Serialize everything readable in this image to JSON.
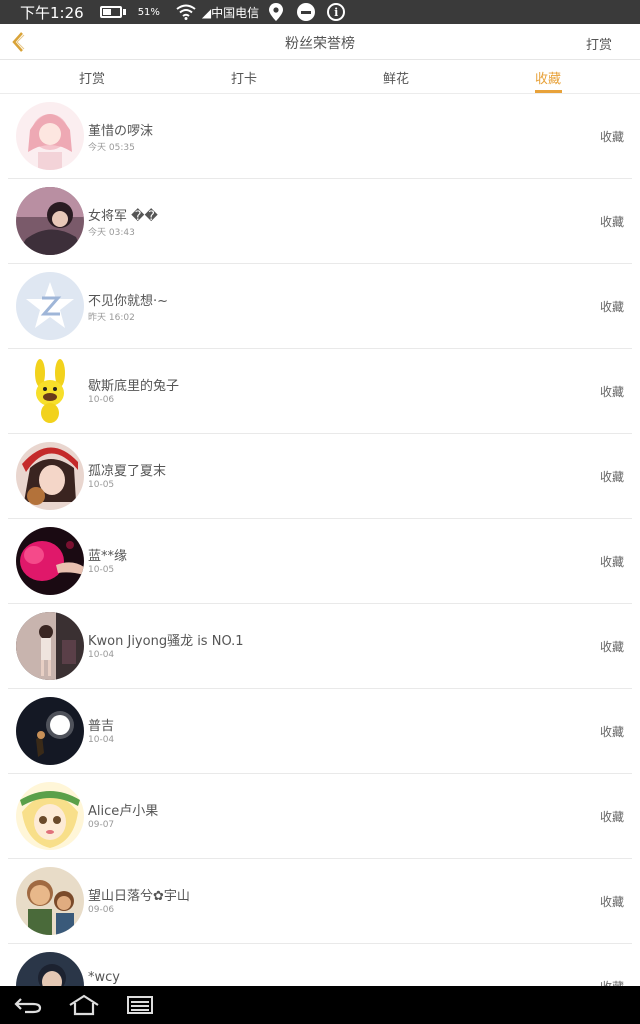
{
  "status_bar": {
    "time": "下午1:26",
    "battery_percent": "51%",
    "battery_level": 0.51,
    "carrier": "◢中国电信",
    "icons": [
      "battery-icon",
      "wifi-icon",
      "signal-icon",
      "location-icon",
      "do-not-disturb-icon",
      "info-icon"
    ]
  },
  "header": {
    "back_icon": "chevron-left-icon",
    "title": "粉丝荣誉榜",
    "right_action": "打赏"
  },
  "tabs": [
    {
      "label": "打赏",
      "active": false
    },
    {
      "label": "打卡",
      "active": false
    },
    {
      "label": "鲜花",
      "active": false
    },
    {
      "label": "收藏",
      "active": true
    }
  ],
  "accent_color": "#e8a23a",
  "fans": [
    {
      "name": "堇惜の啰沫",
      "time": "今天 05:35",
      "action": "收藏"
    },
    {
      "name": "女将军 ��",
      "time": "今天 03:43",
      "action": "收藏"
    },
    {
      "name": "不见你就想·~",
      "time": "昨天 16:02",
      "action": "收藏"
    },
    {
      "name": "歇斯底里的兔子",
      "time": "10-06",
      "action": "收藏"
    },
    {
      "name": "孤凉夏了夏末",
      "time": "10-05",
      "action": "收藏"
    },
    {
      "name": "蓝**缘",
      "time": "10-05",
      "action": "收藏"
    },
    {
      "name": "Kwon Jiyong骚龙 is NO.1",
      "time": "10-04",
      "action": "收藏"
    },
    {
      "name": "普吉",
      "time": "10-04",
      "action": "收藏"
    },
    {
      "name": "Alice卢小果",
      "time": "09-07",
      "action": "收藏"
    },
    {
      "name": "望山日落兮✿宇山",
      "time": "09-06",
      "action": "收藏"
    },
    {
      "name": "*wcy",
      "time": "",
      "action": "收藏"
    }
  ],
  "nav_bar": {
    "icons": [
      "back-icon",
      "home-icon",
      "recent-apps-icon"
    ]
  }
}
